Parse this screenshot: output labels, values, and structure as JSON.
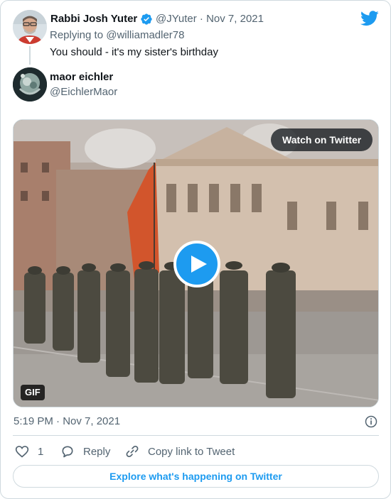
{
  "colors": {
    "accent": "#1d9bf0",
    "text": "#0f1419",
    "muted": "#536471",
    "border": "#cfd9de"
  },
  "parent_tweet": {
    "author_name": "Rabbi Josh Yuter",
    "verified_icon": "verified-badge-icon",
    "handle_date": "@JYuter · Nov 7, 2021",
    "replying_to": "Replying to @williamadler78",
    "text": "You should - it's my sister's birthday"
  },
  "tweet": {
    "author_name": "maor eichler",
    "handle": "@EichlerMaor",
    "media": {
      "watch_label": "Watch on Twitter",
      "badge": "GIF",
      "play_icon": "play-icon"
    },
    "timestamp": "5:19 PM · Nov 7, 2021",
    "info_icon": "info-icon"
  },
  "actions": {
    "likes": "1",
    "reply_label": "Reply",
    "copy_label": "Copy link to Tweet"
  },
  "explore_label": "Explore what's happening on Twitter",
  "brand_icon": "twitter-bird-icon"
}
